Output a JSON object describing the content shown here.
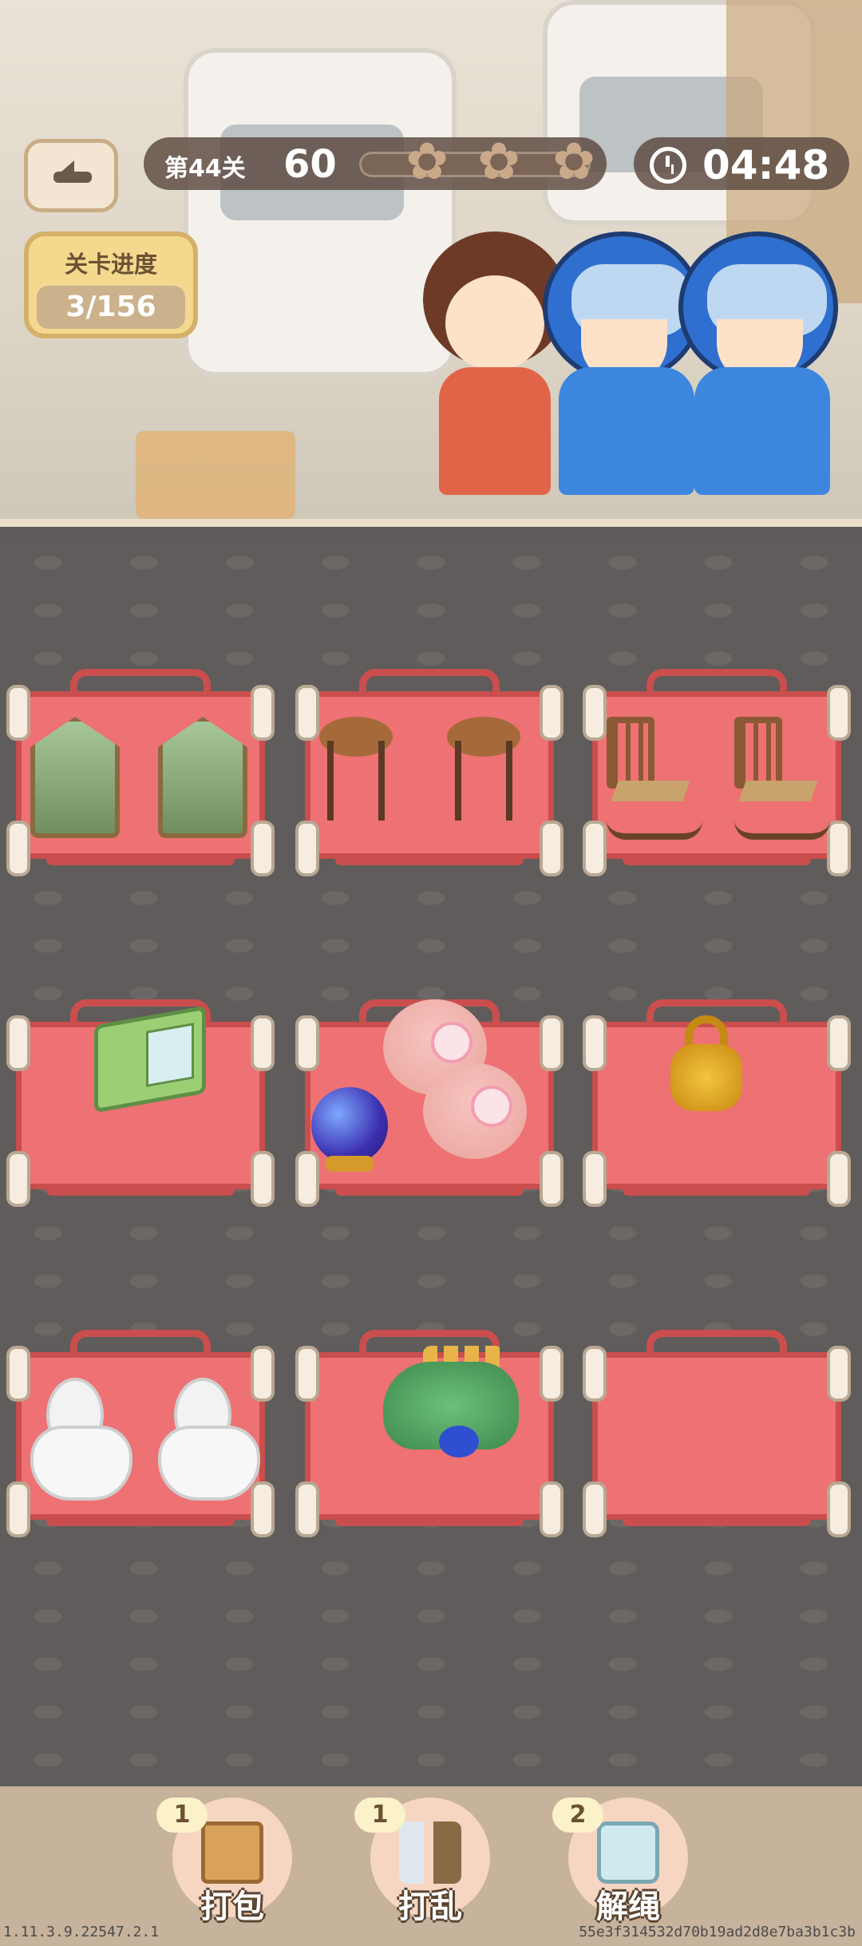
{
  "hud": {
    "level_label": "第44关",
    "score": "60",
    "stars_earned": 0,
    "stars_total": 3,
    "timer": "04:48"
  },
  "stage_progress": {
    "title": "关卡进度",
    "value": "3/156"
  },
  "carts": [
    {
      "items": [
        "terrarium",
        "terrarium"
      ]
    },
    {
      "items": [
        "wooden-stool",
        "wooden-stool"
      ]
    },
    {
      "items": [
        "rocking-chair",
        "rocking-chair"
      ]
    },
    {
      "items": [
        "microwave"
      ]
    },
    {
      "items": [
        "crystal-ball",
        "pink-cushion",
        "pink-cushion"
      ]
    },
    {
      "items": [
        "golden-lock"
      ]
    },
    {
      "items": [
        "toilet",
        "toilet"
      ]
    },
    {
      "items": [
        "dinosaur-toy"
      ]
    },
    {
      "items": []
    }
  ],
  "tools": [
    {
      "label": "打包",
      "count": "1",
      "icon": "box-icon"
    },
    {
      "label": "打乱",
      "count": "1",
      "icon": "shuffle-icon"
    },
    {
      "label": "解绳",
      "count": "2",
      "icon": "rope-icon"
    }
  ],
  "footer": {
    "version": "1.11.3.9.22547.2.1",
    "build_hash": "55e3f314532d70b19ad2d8e7ba3b1c3b"
  },
  "colors": {
    "cart": "#ee7173",
    "hud_bg": "#5f4e44",
    "panel": "#f4d88e"
  }
}
